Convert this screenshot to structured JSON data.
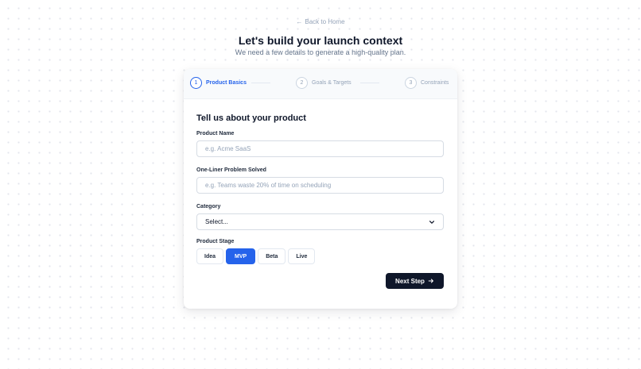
{
  "nav": {
    "back_label": "Back to Home"
  },
  "header": {
    "title": "Let's build your launch context",
    "subtitle": "We need a few details to generate a high-quality plan."
  },
  "steps": [
    {
      "number": "1",
      "label": "Product Basics",
      "active": true
    },
    {
      "number": "2",
      "label": "Goals & Targets",
      "active": false
    },
    {
      "number": "3",
      "label": "Constraints",
      "active": false
    }
  ],
  "form": {
    "section_title": "Tell us about your product",
    "product_name": {
      "label": "Product Name",
      "placeholder": "e.g. Acme SaaS",
      "value": ""
    },
    "problem": {
      "label": "One-Liner Problem Solved",
      "placeholder": "e.g. Teams waste 20% of time on scheduling",
      "value": ""
    },
    "category": {
      "label": "Category",
      "selected": "Select..."
    },
    "stage": {
      "label": "Product Stage",
      "options": [
        "Idea",
        "MVP",
        "Beta",
        "Live"
      ],
      "selected": "MVP"
    },
    "next_label": "Next Step"
  },
  "colors": {
    "accent": "#2563eb",
    "primary_dark": "#0f172a"
  },
  "icons": {
    "back": "arrow-left-icon",
    "next": "arrow-right-icon",
    "select": "chevron-down-icon"
  }
}
